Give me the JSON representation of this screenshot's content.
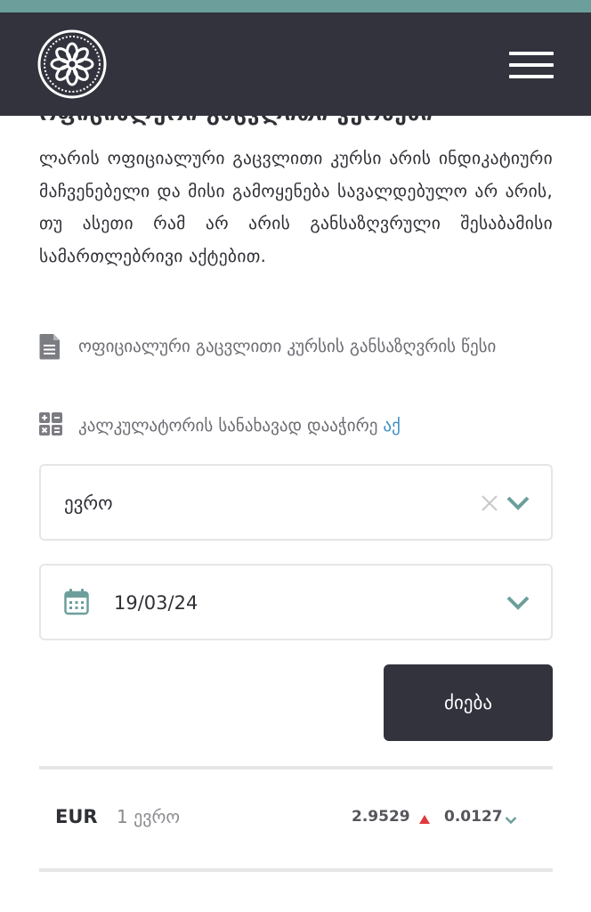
{
  "header": {
    "logo_icon": "nbg-flower-seal-logo",
    "menu_icon": "hamburger-menu-icon"
  },
  "section_heading": "ოფიციალური გაცვლითი კურსები",
  "description": "ლარის ოფიციალური გაცვლითი კურსი არის ინდიკატიური მაჩვენებელი და მისი გამოყენება სავალდებულო არ არის, თუ ასეთი რამ არ არის განსაზღვრული შესაბამისი სამართლებრივი აქტებით.",
  "links": {
    "rules_text": "ოფიციალური გაცვლითი კურსის განსაზღვრის წესი",
    "calculator_text": "კალკულატორის სანახავად დააჭირე ",
    "calculator_link": "აქ"
  },
  "filters": {
    "currency_value": "ევრო",
    "date_value": "19/03/24",
    "search_label": "ძიება"
  },
  "rates": [
    {
      "code": "EUR",
      "name": "1 ევრო",
      "rate": "2.9529",
      "diff": "0.0127",
      "trend": "up"
    }
  ],
  "colors": {
    "header": "#32333d",
    "accent": "#6c9f9b",
    "link": "#3d8fc6",
    "trend_up": "#e0393e"
  }
}
